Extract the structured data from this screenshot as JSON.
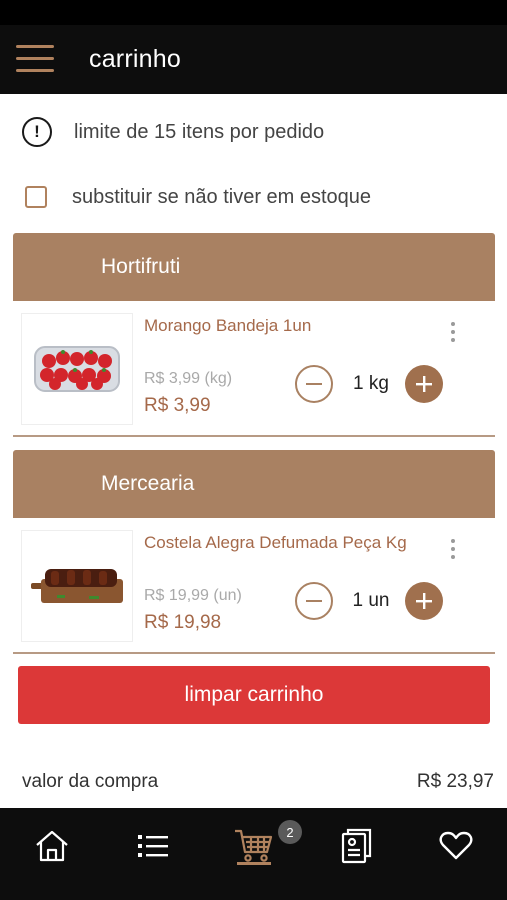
{
  "header": {
    "title": "carrinho"
  },
  "notice": {
    "text": "limite de 15 itens por pedido"
  },
  "substitute": {
    "label": "substituir se não tiver em estoque"
  },
  "categories": [
    {
      "name": "Hortifruti",
      "items": [
        {
          "name": "Morango Bandeja 1un",
          "unit_price": "R$ 3,99 (kg)",
          "price": "R$ 3,99",
          "quantity": "1 kg"
        }
      ]
    },
    {
      "name": "Mercearia",
      "items": [
        {
          "name": "Costela Alegra Defumada Peça Kg",
          "unit_price": "R$ 19,99 (un)",
          "price": "R$ 19,98",
          "quantity": "1 un"
        }
      ]
    }
  ],
  "clear_button": "limpar carrinho",
  "total": {
    "label": "valor da compra",
    "value": "R$ 23,97"
  },
  "bottom_nav": {
    "cart_count": "2",
    "items": [
      "home-icon",
      "list-icon",
      "cart-icon",
      "receipt-icon",
      "heart-icon"
    ]
  },
  "colors": {
    "accent": "#a98162",
    "price": "#a5694a",
    "danger": "#dc3838",
    "bar": "#0d0d0d"
  }
}
